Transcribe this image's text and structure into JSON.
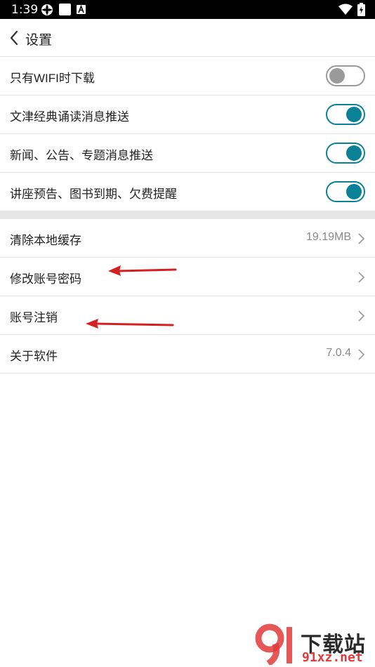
{
  "status_bar": {
    "time": "1:39",
    "icons": [
      "settings-gear-icon",
      "square-notification-icon",
      "a-notification-icon",
      "wifi-icon",
      "battery-charging-icon"
    ]
  },
  "header": {
    "title": "设置",
    "back_icon": "chevron-left-icon"
  },
  "toggles": [
    {
      "label": "只有WIFI时下载",
      "on": false
    },
    {
      "label": "文津经典诵读消息推送",
      "on": true
    },
    {
      "label": "新闻、公告、专题消息推送",
      "on": true
    },
    {
      "label": "讲座预告、图书到期、欠费提醒",
      "on": true
    }
  ],
  "items": [
    {
      "label": "清除本地缓存",
      "value": "19.19MB"
    },
    {
      "label": "修改账号密码",
      "value": ""
    },
    {
      "label": "账号注销",
      "value": ""
    },
    {
      "label": "关于软件",
      "value": "7.0.4"
    }
  ],
  "colors": {
    "accent": "#0a8196",
    "toggle_off": "#9a9a9a",
    "annotation_arrow": "#d42020"
  },
  "watermark": {
    "main": "下载站",
    "domain": "91xz.net",
    "logo_icon": "91-logo-icon"
  }
}
